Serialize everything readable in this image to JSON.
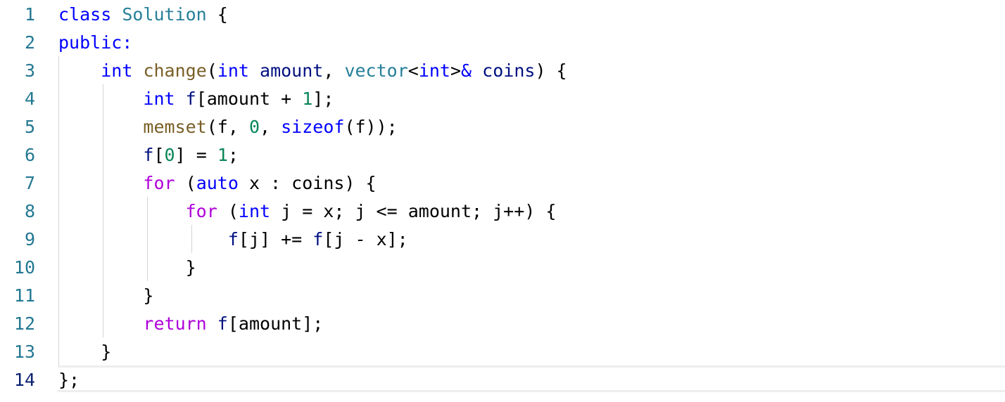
{
  "editor": {
    "language": "cpp",
    "current_line": 14,
    "lines": [
      {
        "number": "1",
        "tokens": [
          {
            "text": "class",
            "kind": "keyword"
          },
          {
            "text": " ",
            "kind": "plain"
          },
          {
            "text": "Solution",
            "kind": "type"
          },
          {
            "text": " {",
            "kind": "plain"
          }
        ]
      },
      {
        "number": "2",
        "tokens": [
          {
            "text": "public:",
            "kind": "keyword"
          }
        ]
      },
      {
        "number": "3",
        "tokens": [
          {
            "text": "    ",
            "kind": "plain"
          },
          {
            "text": "int",
            "kind": "keyword"
          },
          {
            "text": " ",
            "kind": "plain"
          },
          {
            "text": "change",
            "kind": "func"
          },
          {
            "text": "(",
            "kind": "plain"
          },
          {
            "text": "int",
            "kind": "keyword"
          },
          {
            "text": " ",
            "kind": "plain"
          },
          {
            "text": "amount",
            "kind": "var"
          },
          {
            "text": ", ",
            "kind": "plain"
          },
          {
            "text": "vector",
            "kind": "type"
          },
          {
            "text": "<",
            "kind": "plain"
          },
          {
            "text": "int",
            "kind": "keyword"
          },
          {
            "text": ">",
            "kind": "plain"
          },
          {
            "text": "&",
            "kind": "keyword"
          },
          {
            "text": " ",
            "kind": "plain"
          },
          {
            "text": "coins",
            "kind": "var"
          },
          {
            "text": ") {",
            "kind": "plain"
          }
        ]
      },
      {
        "number": "4",
        "tokens": [
          {
            "text": "        ",
            "kind": "plain"
          },
          {
            "text": "int",
            "kind": "keyword"
          },
          {
            "text": " ",
            "kind": "plain"
          },
          {
            "text": "f",
            "kind": "var"
          },
          {
            "text": "[amount + ",
            "kind": "plain"
          },
          {
            "text": "1",
            "kind": "num"
          },
          {
            "text": "];",
            "kind": "plain"
          }
        ]
      },
      {
        "number": "5",
        "tokens": [
          {
            "text": "        ",
            "kind": "plain"
          },
          {
            "text": "memset",
            "kind": "func"
          },
          {
            "text": "(f, ",
            "kind": "plain"
          },
          {
            "text": "0",
            "kind": "num"
          },
          {
            "text": ", ",
            "kind": "plain"
          },
          {
            "text": "sizeof",
            "kind": "keyword"
          },
          {
            "text": "(f));",
            "kind": "plain"
          }
        ]
      },
      {
        "number": "6",
        "tokens": [
          {
            "text": "        ",
            "kind": "plain"
          },
          {
            "text": "f",
            "kind": "var"
          },
          {
            "text": "[",
            "kind": "plain"
          },
          {
            "text": "0",
            "kind": "num"
          },
          {
            "text": "] = ",
            "kind": "plain"
          },
          {
            "text": "1",
            "kind": "num"
          },
          {
            "text": ";",
            "kind": "plain"
          }
        ]
      },
      {
        "number": "7",
        "tokens": [
          {
            "text": "        ",
            "kind": "plain"
          },
          {
            "text": "for",
            "kind": "control"
          },
          {
            "text": " (",
            "kind": "plain"
          },
          {
            "text": "auto",
            "kind": "keyword"
          },
          {
            "text": " x : coins) {",
            "kind": "plain"
          }
        ]
      },
      {
        "number": "8",
        "tokens": [
          {
            "text": "            ",
            "kind": "plain"
          },
          {
            "text": "for",
            "kind": "control"
          },
          {
            "text": " (",
            "kind": "plain"
          },
          {
            "text": "int",
            "kind": "keyword"
          },
          {
            "text": " j = x; j <= amount; j++) {",
            "kind": "plain"
          }
        ]
      },
      {
        "number": "9",
        "tokens": [
          {
            "text": "                ",
            "kind": "plain"
          },
          {
            "text": "f",
            "kind": "var"
          },
          {
            "text": "[j] += ",
            "kind": "plain"
          },
          {
            "text": "f",
            "kind": "var"
          },
          {
            "text": "[j - x];",
            "kind": "plain"
          }
        ]
      },
      {
        "number": "10",
        "tokens": [
          {
            "text": "            }",
            "kind": "plain"
          }
        ]
      },
      {
        "number": "11",
        "tokens": [
          {
            "text": "        }",
            "kind": "plain"
          }
        ]
      },
      {
        "number": "12",
        "tokens": [
          {
            "text": "        ",
            "kind": "plain"
          },
          {
            "text": "return",
            "kind": "control"
          },
          {
            "text": " ",
            "kind": "plain"
          },
          {
            "text": "f",
            "kind": "var"
          },
          {
            "text": "[amount];",
            "kind": "plain"
          }
        ]
      },
      {
        "number": "13",
        "tokens": [
          {
            "text": "    }",
            "kind": "plain"
          }
        ]
      },
      {
        "number": "14",
        "tokens": [
          {
            "text": "};",
            "kind": "plain"
          }
        ]
      }
    ],
    "colors": {
      "keyword": "#0000ff",
      "control": "#af00db",
      "type": "#267f99",
      "function": "#795e26",
      "variable": "#001080",
      "number": "#098658",
      "line_number": "#237893",
      "current_line_number": "#0b216f",
      "indent_guide": "#d3d3d3",
      "current_line_border": "#eeeeee"
    }
  }
}
